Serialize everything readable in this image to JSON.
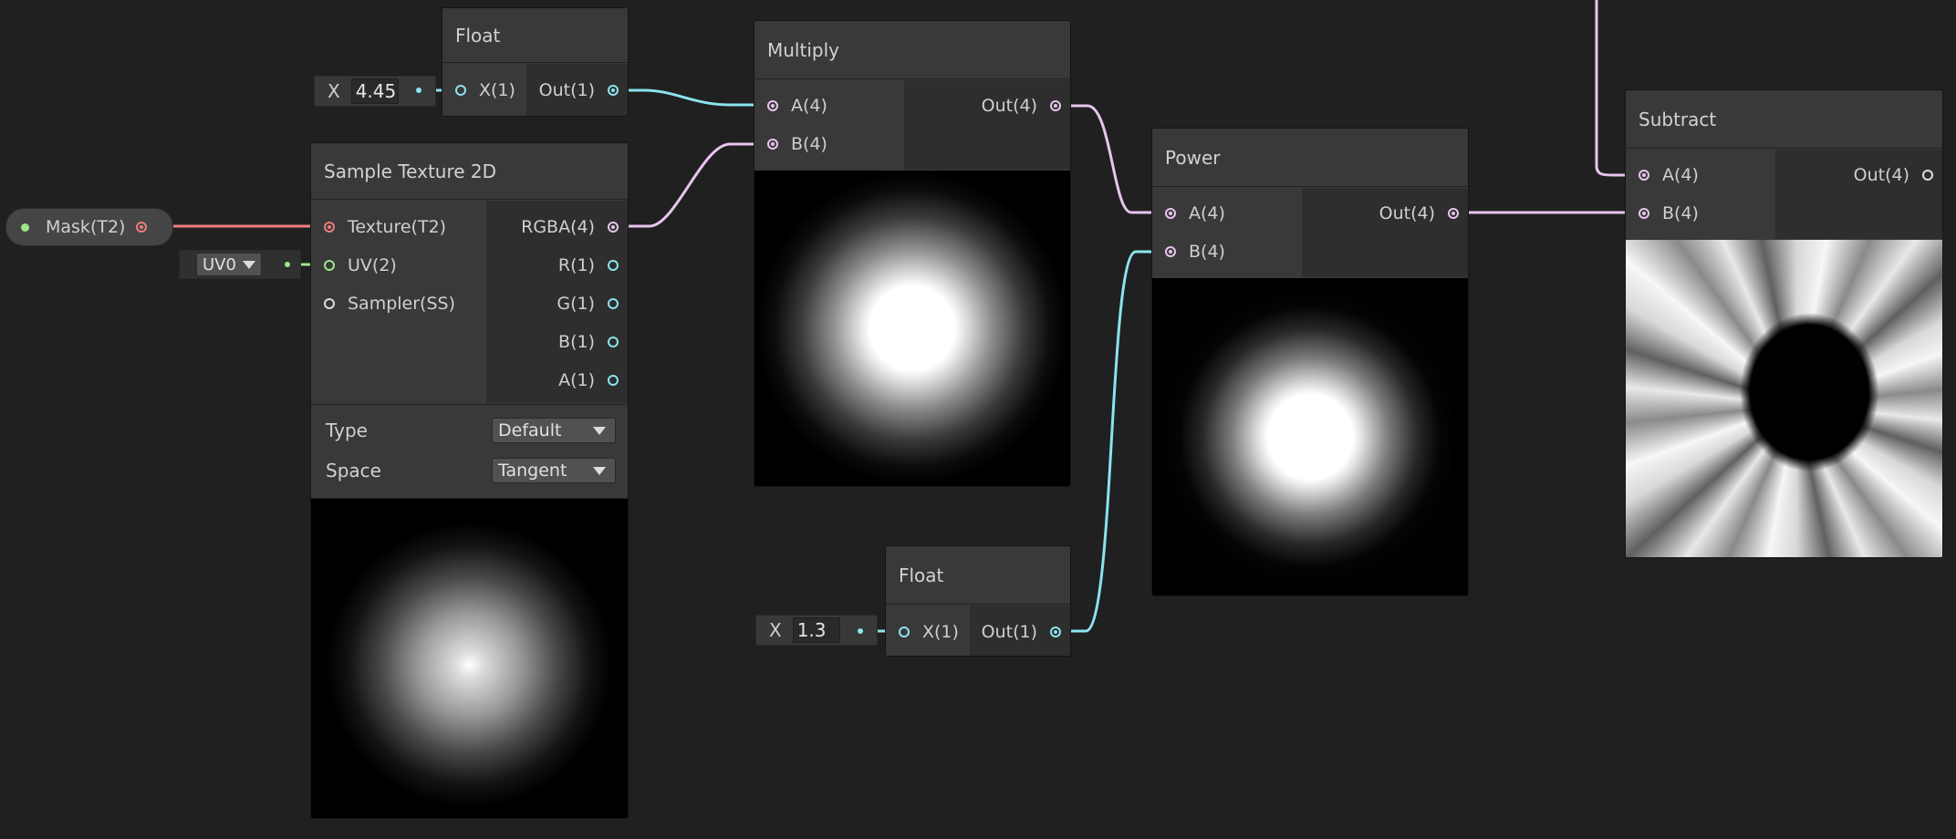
{
  "nodes": {
    "float_top": {
      "title": "Float",
      "inputs": [
        "X(1)"
      ],
      "outputs": [
        "Out(1)"
      ],
      "field_label": "X",
      "field_value": "4.45"
    },
    "float_bottom": {
      "title": "Float",
      "inputs": [
        "X(1)"
      ],
      "outputs": [
        "Out(1)"
      ],
      "field_label": "X",
      "field_value": "1.3"
    },
    "sample_texture": {
      "title": "Sample Texture 2D",
      "inputs": [
        "Texture(T2)",
        "UV(2)",
        "Sampler(SS)"
      ],
      "outputs": [
        "RGBA(4)",
        "R(1)",
        "G(1)",
        "B(1)",
        "A(1)"
      ],
      "uv_dropdown": "UV0",
      "type_label": "Type",
      "type_value": "Default",
      "space_label": "Space",
      "space_value": "Tangent"
    },
    "multiply": {
      "title": "Multiply",
      "inputs": [
        "A(4)",
        "B(4)"
      ],
      "outputs": [
        "Out(4)"
      ]
    },
    "power": {
      "title": "Power",
      "inputs": [
        "A(4)",
        "B(4)"
      ],
      "outputs": [
        "Out(4)"
      ]
    },
    "subtract": {
      "title": "Subtract",
      "inputs": [
        "A(4)",
        "B(4)"
      ],
      "outputs": [
        "Out(4)"
      ]
    }
  },
  "property": {
    "label": "Mask(T2)"
  },
  "colors": {
    "background": "#202020",
    "wire_vector4": "#e8c4ee",
    "wire_float": "#8ae4ee",
    "wire_texture": "#ee7d7d",
    "wire_uv": "#9ee58c"
  }
}
